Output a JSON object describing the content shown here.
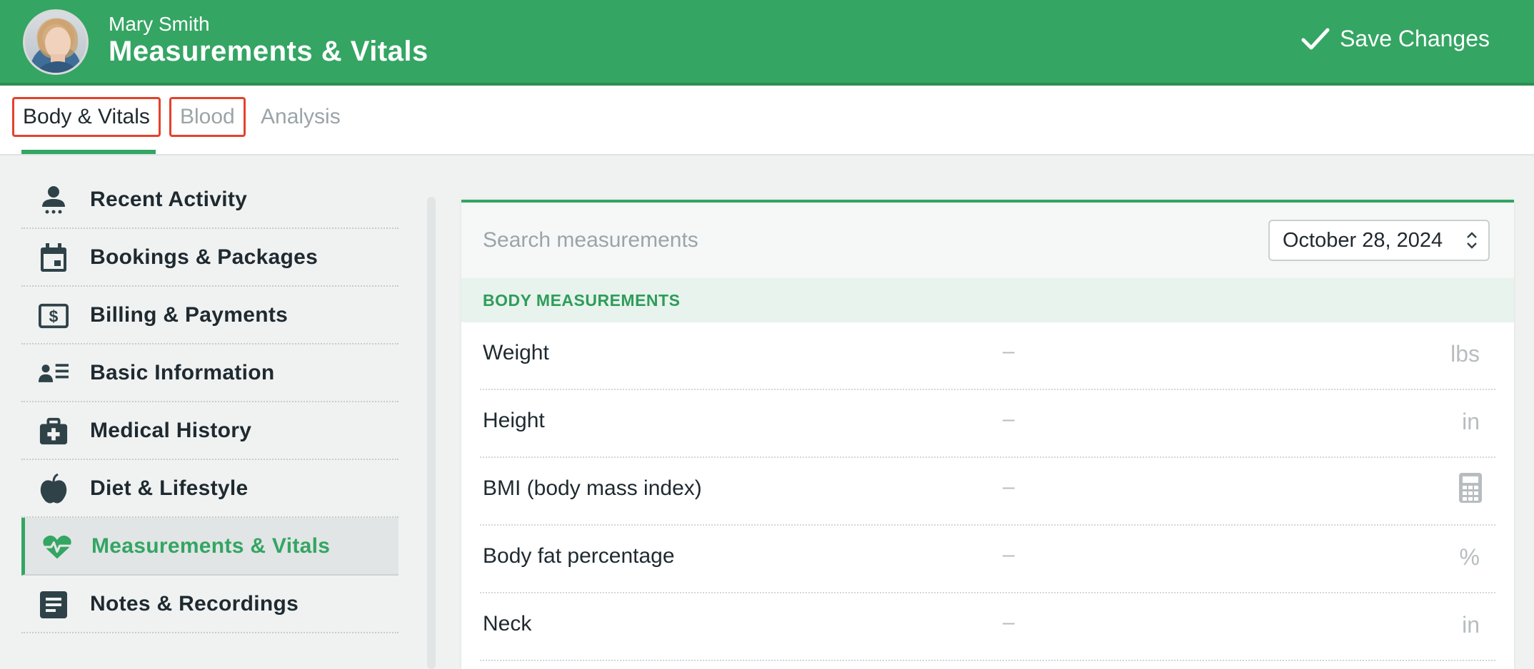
{
  "header": {
    "user_name": "Mary Smith",
    "title": "Measurements & Vitals",
    "save_label": "Save Changes",
    "brand_color": "#34a563"
  },
  "tabs": [
    {
      "label": "Body & Vitals",
      "active": true
    },
    {
      "label": "Blood",
      "active": false
    },
    {
      "label": "Analysis",
      "active": false
    }
  ],
  "sidebar": {
    "items": [
      {
        "label": "Recent Activity",
        "icon": "person-icon"
      },
      {
        "label": "Bookings & Packages",
        "icon": "calendar-icon"
      },
      {
        "label": "Billing & Payments",
        "icon": "dollar-bill-icon"
      },
      {
        "label": "Basic Information",
        "icon": "contact-list-icon"
      },
      {
        "label": "Medical History",
        "icon": "medical-kit-icon"
      },
      {
        "label": "Diet & Lifestyle",
        "icon": "apple-icon"
      },
      {
        "label": "Measurements & Vitals",
        "icon": "heart-pulse-icon",
        "active": true
      },
      {
        "label": "Notes & Recordings",
        "icon": "notes-icon"
      }
    ]
  },
  "panel": {
    "search_placeholder": "Search measurements",
    "date": "October 28, 2024",
    "section_title": "BODY MEASUREMENTS",
    "rows": [
      {
        "label": "Weight",
        "value": "–",
        "unit": "lbs"
      },
      {
        "label": "Height",
        "value": "–",
        "unit": "in"
      },
      {
        "label": "BMI (body mass index)",
        "value": "–",
        "unit": "",
        "unit_icon": "calculator-icon"
      },
      {
        "label": "Body fat percentage",
        "value": "–",
        "unit": "%"
      },
      {
        "label": "Neck",
        "value": "–",
        "unit": "in"
      }
    ]
  }
}
